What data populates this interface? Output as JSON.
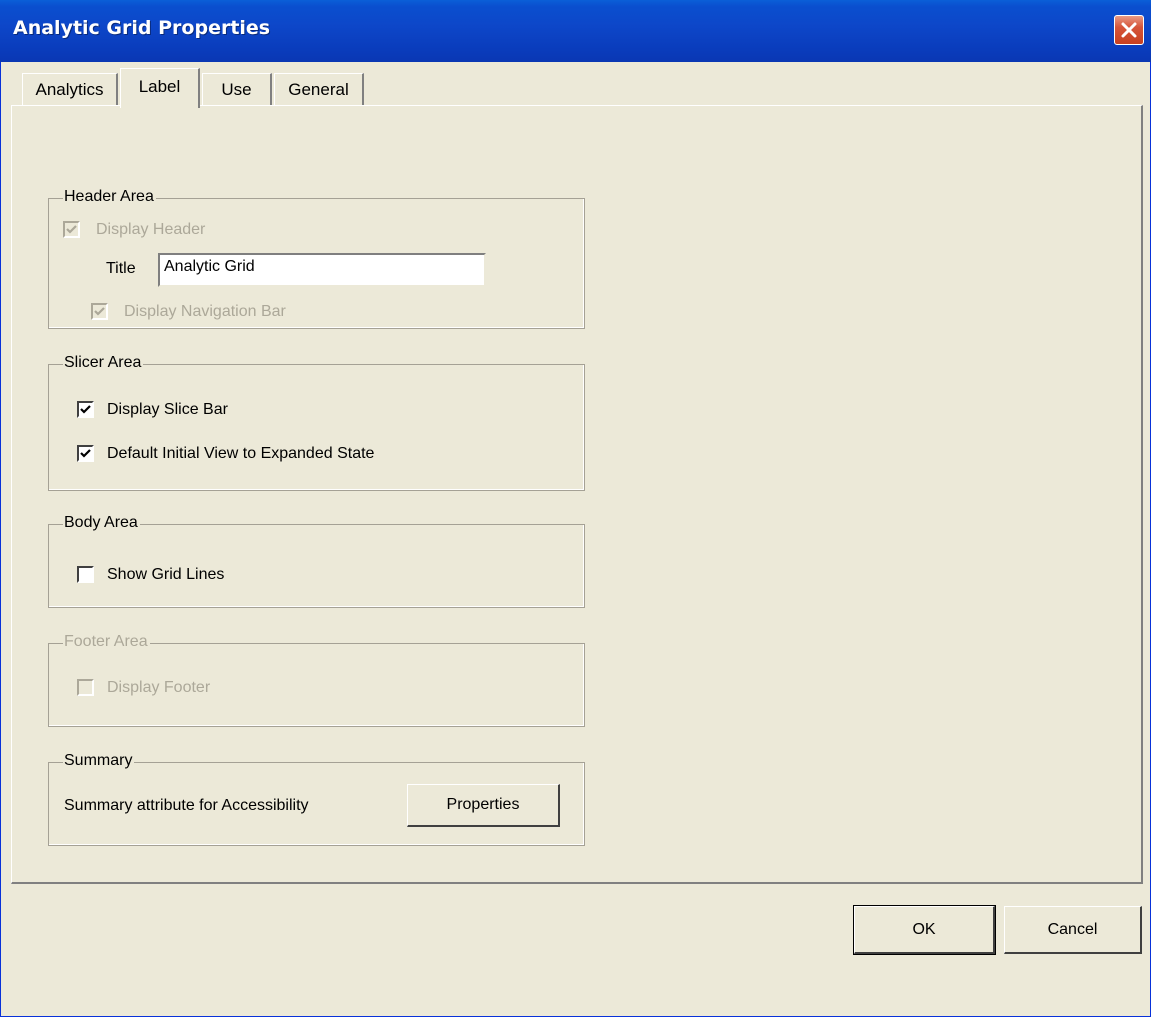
{
  "window": {
    "title": "Analytic Grid Properties"
  },
  "tabs": [
    {
      "label": "Analytics"
    },
    {
      "label": "Label"
    },
    {
      "label": "Use"
    },
    {
      "label": "General"
    }
  ],
  "active_tab": "Label",
  "header_area": {
    "legend": "Header Area",
    "display_header": {
      "label": "Display Header",
      "checked": true,
      "disabled": true
    },
    "title_label": "Title",
    "title_value": "Analytic Grid",
    "display_navigation_bar": {
      "label": "Display Navigation Bar",
      "checked": true,
      "disabled": true
    }
  },
  "slicer_area": {
    "legend": "Slicer Area",
    "display_slice_bar": {
      "label": "Display Slice Bar",
      "checked": true
    },
    "default_initial_view": {
      "label": "Default Initial View to Expanded State",
      "checked": true
    }
  },
  "body_area": {
    "legend": "Body Area",
    "show_grid_lines": {
      "label": "Show Grid Lines",
      "checked": false
    }
  },
  "footer_area": {
    "legend": "Footer Area",
    "display_footer": {
      "label": "Display Footer",
      "checked": false,
      "disabled": true
    }
  },
  "summary": {
    "legend": "Summary",
    "text": "Summary attribute for Accessibility",
    "properties_button": "Properties"
  },
  "buttons": {
    "ok": "OK",
    "cancel": "Cancel"
  },
  "icons": {
    "close": "close-icon",
    "checkmark": "checkmark-icon"
  }
}
